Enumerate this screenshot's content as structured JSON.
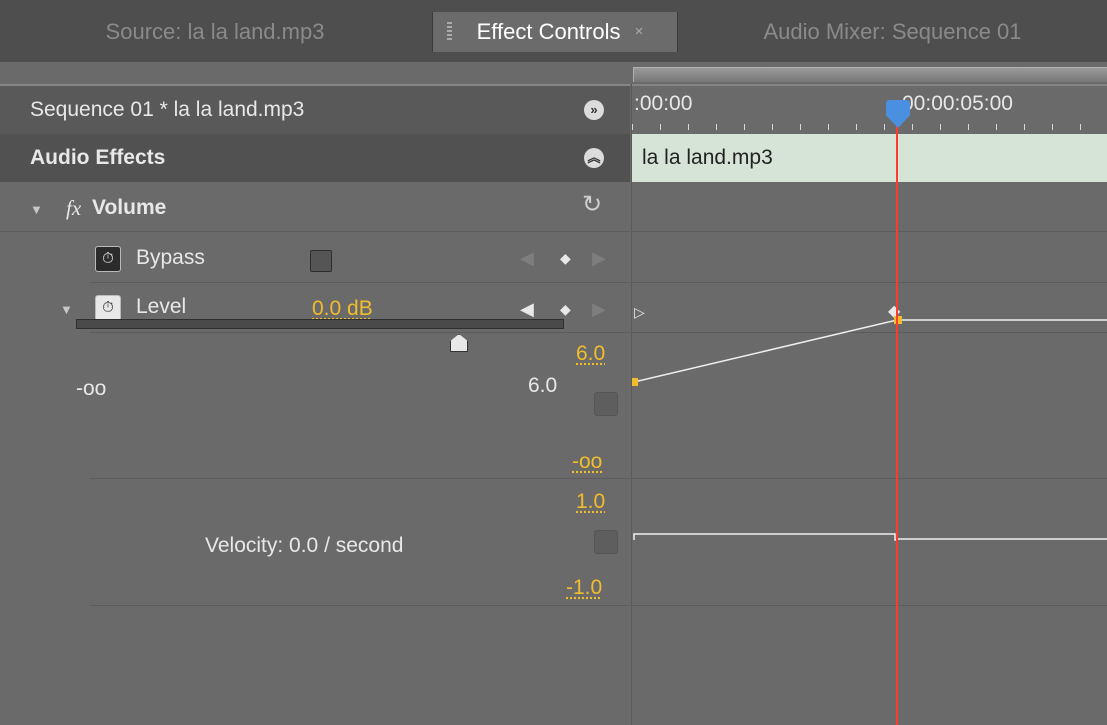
{
  "tabs": [
    {
      "label": "Source: la la land.mp3",
      "active": false
    },
    {
      "label": "Effect Controls",
      "active": true,
      "close": "×"
    },
    {
      "label": "Audio Mixer: Sequence 01",
      "active": false
    }
  ],
  "sequence_header": {
    "title": "Sequence 01 * la la land.mp3",
    "button_icon": "show-timeline-icon"
  },
  "section": {
    "title": "Audio Effects",
    "button_icon": "collapse-icon"
  },
  "effect": {
    "fx_symbol": "fx",
    "name": "Volume",
    "reset_icon": "reset-icon"
  },
  "bypass": {
    "label": "Bypass",
    "checked": false
  },
  "level": {
    "label": "Level",
    "value": "0.0 dB",
    "graph_max": "6.0",
    "graph_min": "-oo",
    "slider_min": "-oo",
    "slider_max": "6.0",
    "slider_position_fraction": 0.79
  },
  "velocity": {
    "label": "Velocity: 0.0 / second",
    "max": "1.0",
    "min": "-1.0"
  },
  "timeline": {
    "start_time": ":00:00",
    "end_time": "00:00:05:00",
    "clip_name": "la la land.mp3"
  },
  "colors": {
    "accent_yellow": "#f2bd2c",
    "playhead": "#ff3b2e",
    "clip_bar": "#d6e4d8",
    "playhead_marker": "#4b8fe0"
  }
}
